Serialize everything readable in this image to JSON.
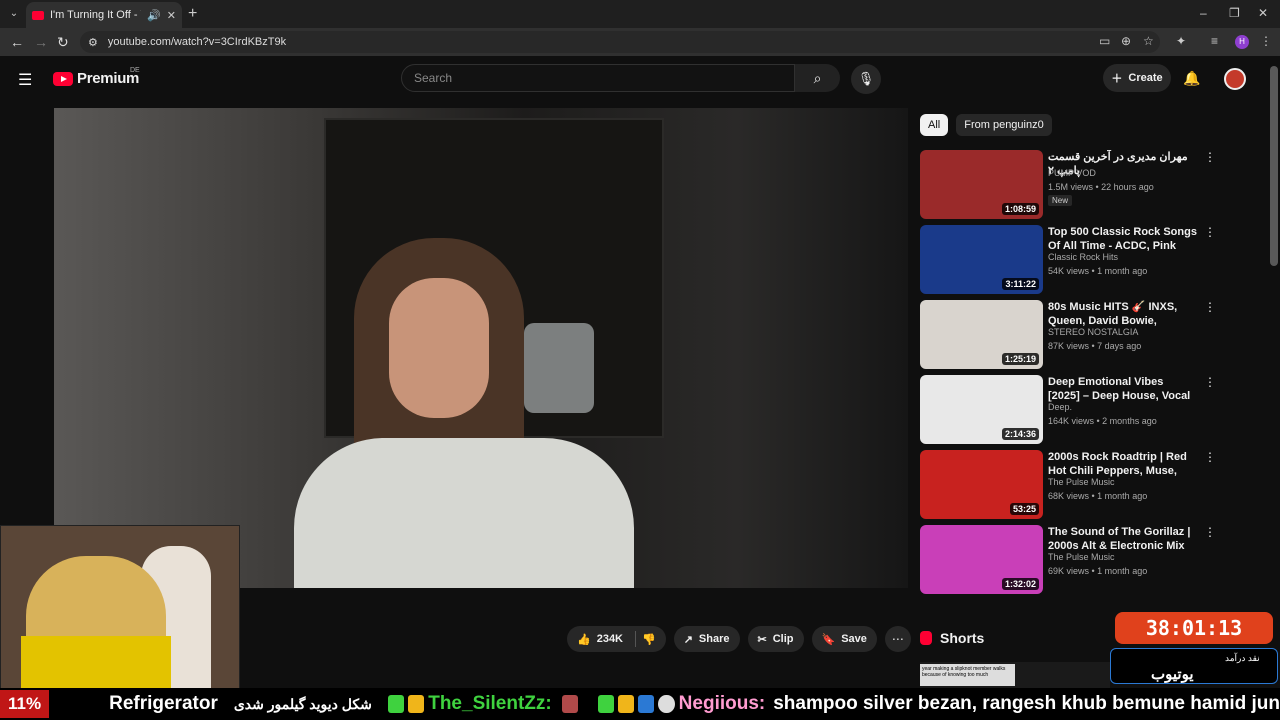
{
  "browser": {
    "tab_title": "I'm Turning It Off - YouTube",
    "url": "youtube.com/watch?v=3CIrdKBzT9k",
    "profile_initial": "H"
  },
  "youtube": {
    "logo_text": "Premium",
    "region": "DE",
    "search_placeholder": "Search",
    "create_label": "Create"
  },
  "actions": {
    "likes": "234K",
    "share": "Share",
    "clip": "Clip",
    "save": "Save"
  },
  "chips": [
    "All",
    "From penguinz0"
  ],
  "recommendations": [
    {
      "title": "مهران مدیری در آخرین قسمت پامپ ۲",
      "channel": "PUMP VOD",
      "verified": true,
      "meta": "1.5M views • 22 hours ago",
      "badge": "New",
      "duration": "1:08:59",
      "thumb_color": "#9a2a2a"
    },
    {
      "title": "Top 500 Classic Rock Songs Of All Time - ACDC, Pink Floyd, ...",
      "channel": "Classic Rock Hits",
      "meta": "54K views • 1 month ago",
      "duration": "3:11:22",
      "thumb_color": "#1a3a8a"
    },
    {
      "title": "80s Music HITS 🎸 INXS, Queen, David Bowie, Eurythmics, a-ha,...",
      "channel": "STEREO NOSTALGIA",
      "meta": "87K views • 7 days ago",
      "duration": "1:25:19",
      "thumb_color": "#d9d4ce"
    },
    {
      "title": "Deep Emotional Vibes [2025] – Deep House, Vocal House, Nu ...",
      "channel": "Deep.",
      "meta": "164K views • 2 months ago",
      "duration": "2:14:36",
      "thumb_color": "#e8e8e8"
    },
    {
      "title": "2000s Rock Roadtrip | Red Hot Chili Peppers, Muse, Linkin Pa...",
      "channel": "The Pulse Music",
      "meta": "68K views • 1 month ago",
      "duration": "53:25",
      "thumb_color": "#c8221f"
    },
    {
      "title": "The Sound of The Gorillaz | 2000s Alt & Electronic Mix",
      "channel": "The Pulse Music",
      "meta": "69K views • 1 month ago",
      "duration": "1:32:02",
      "thumb_color": "#c93fb8"
    }
  ],
  "shorts_label": "Shorts",
  "shorts_preview_text": "year making a slipknot member walks because of knowing too much",
  "overlay": {
    "timer": "38:01:13",
    "donate_small": "نقد\nدرآمد",
    "donate_large": "یوتیوب"
  },
  "ticker": {
    "percent": "11%",
    "item1": "Refrigerator",
    "item2": "شکل دیوید گیلمور شدی",
    "user1": "The_SilentZz:",
    "user2": "Negiious:",
    "message": "shampoo silver bezan, rangesh khub bemune hamid jun"
  },
  "colors": {
    "accent_red": "#ff0033",
    "timer_bg": "#e0411c",
    "ticker_user1": "#3fd23f",
    "ticker_user2": "#ff9bd0"
  }
}
